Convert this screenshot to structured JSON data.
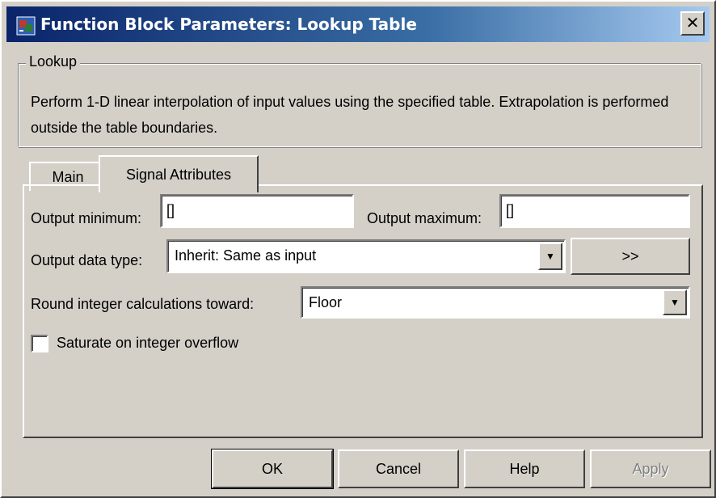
{
  "window": {
    "title": "Function Block Parameters: Lookup Table",
    "close_label": "✕"
  },
  "group": {
    "legend": "Lookup",
    "description": "Perform 1-D linear interpolation of input values using the specified table.  Extrapolation is performed outside the table boundaries."
  },
  "tabs": {
    "main_label": "Main",
    "signal_label": "Signal Attributes",
    "active": "Signal Attributes"
  },
  "fields": {
    "output_min_label": "Output minimum:",
    "output_min_value": "[]",
    "output_max_label": "Output maximum:",
    "output_max_value": "[]",
    "data_type_label": "Output data type:",
    "data_type_value": "Inherit: Same as input",
    "data_type_button": ">>",
    "round_label": "Round integer calculations toward:",
    "round_value": "Floor",
    "saturate_label": "Saturate on integer overflow",
    "saturate_checked": false
  },
  "buttons": {
    "ok": "OK",
    "cancel": "Cancel",
    "help": "Help",
    "apply": "Apply"
  },
  "colors": {
    "titlebar_start": "#0a246a",
    "titlebar_end": "#a6caf0",
    "face": "#d4d0c8"
  },
  "icons": {
    "app": "simulink-block-icon",
    "dropdown": "dropdown-arrow-icon",
    "close": "close-icon"
  }
}
